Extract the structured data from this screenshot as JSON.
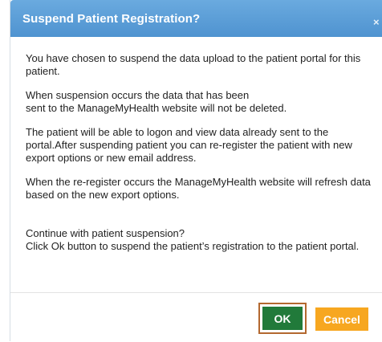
{
  "dialog": {
    "title": "Suspend Patient Registration?",
    "close_glyph": "×",
    "paragraphs": [
      "You have chosen to suspend the data upload to the patient portal for this patient.",
      "When suspension occurs the data that has been\nsent to the ManageMyHealth website will not be deleted.",
      "The patient will be able to logon and view data already sent to the portal.After suspending patient you can re-register the patient with new export options or new email address.",
      "When the re-register occurs the ManageMyHealth website will refresh data based on the new export options.",
      "Continue with patient suspension?\nClick Ok button to suspend the patient’s registration to the patient portal."
    ],
    "ok_label": "OK",
    "cancel_label": "Cancel"
  },
  "colors": {
    "titlebar": "#5fa1d9",
    "ok_button": "#217a3a",
    "ok_highlight_border": "#b3682f",
    "cancel_button": "#f7a720"
  },
  "icons": {
    "close": "close-icon"
  }
}
